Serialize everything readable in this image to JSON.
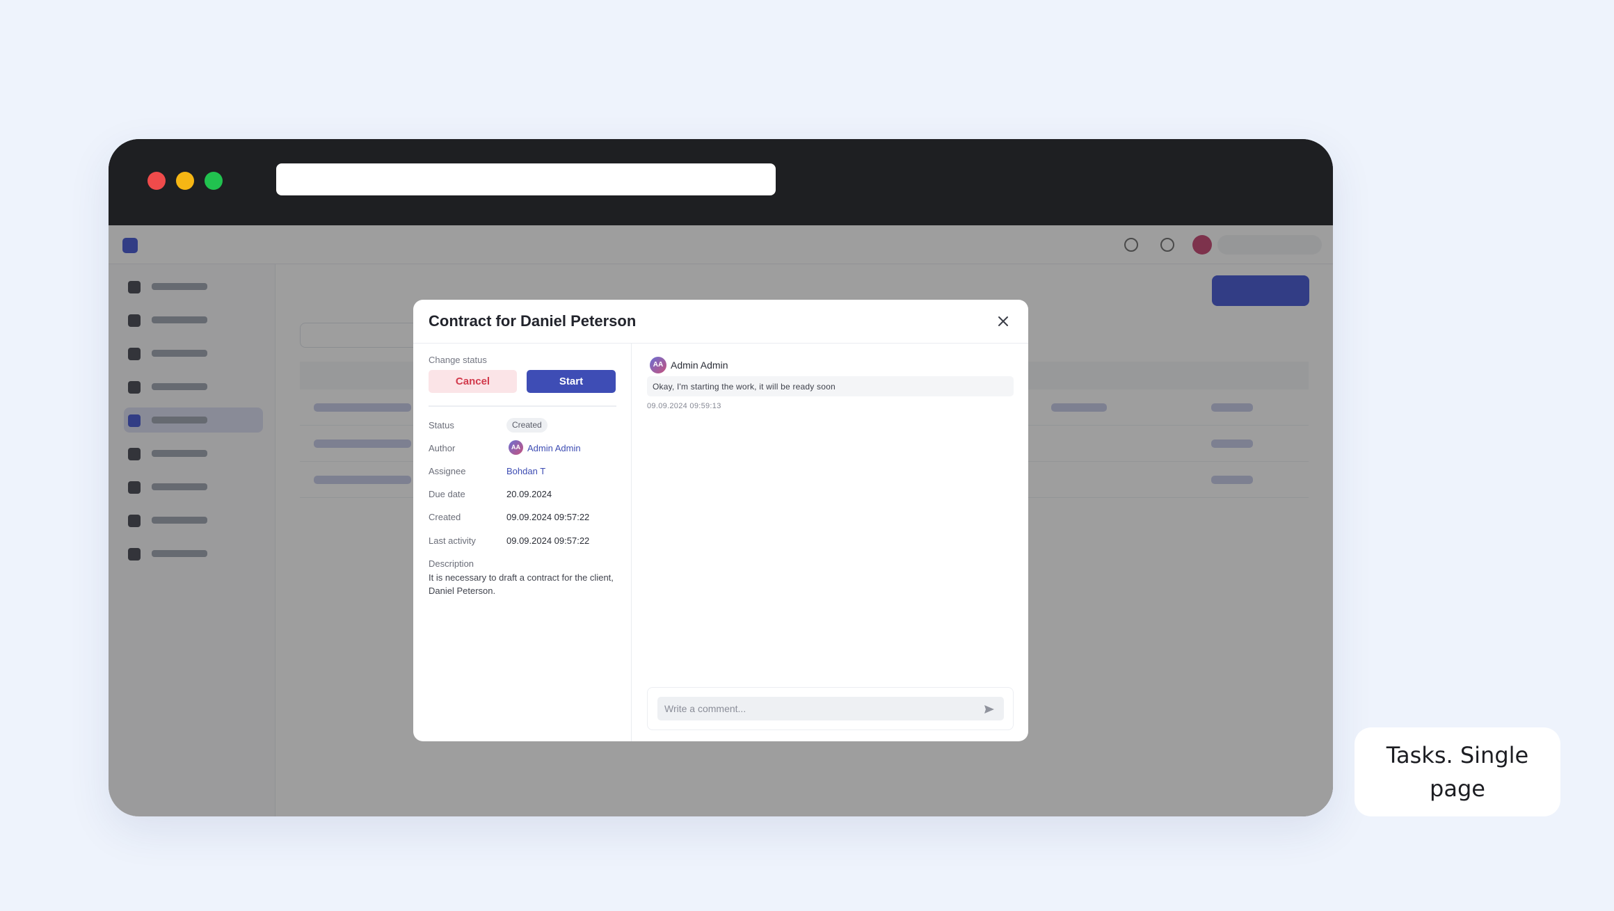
{
  "modal": {
    "title": "Contract for Daniel Peterson",
    "change_status_label": "Change status",
    "buttons": {
      "cancel": "Cancel",
      "start": "Start"
    },
    "fields": {
      "status": {
        "label": "Status",
        "value": "Created"
      },
      "author": {
        "label": "Author",
        "initials": "AA",
        "value": "Admin Admin"
      },
      "assignee": {
        "label": "Assignee",
        "value": "Bohdan T"
      },
      "due_date": {
        "label": "Due date",
        "value": "20.09.2024"
      },
      "created": {
        "label": "Created",
        "value": "09.09.2024 09:57:22"
      },
      "last_activity": {
        "label": "Last activity",
        "value": "09.09.2024 09:57:22"
      },
      "description": {
        "label": "Description",
        "value": "It is necessary to draft a contract for the client, Daniel Peterson."
      }
    },
    "comments": [
      {
        "initials": "AA",
        "author": "Admin Admin",
        "text": "Okay, I'm starting the work, it will be ready soon",
        "time": "09.09.2024 09:59:13"
      }
    ],
    "composer": {
      "placeholder": "Write a comment..."
    }
  },
  "caption": "Tasks. Single page",
  "colors": {
    "page_background": "#eef3fc",
    "browser_frame": "#1e1f22",
    "accent": "#3e4db5",
    "cancel_background": "#fbe4e7",
    "cancel_text": "#d23a4c"
  },
  "icons": [
    "close-icon",
    "send-icon",
    "window-close-dot",
    "window-minimize-dot",
    "window-maximize-dot"
  ]
}
